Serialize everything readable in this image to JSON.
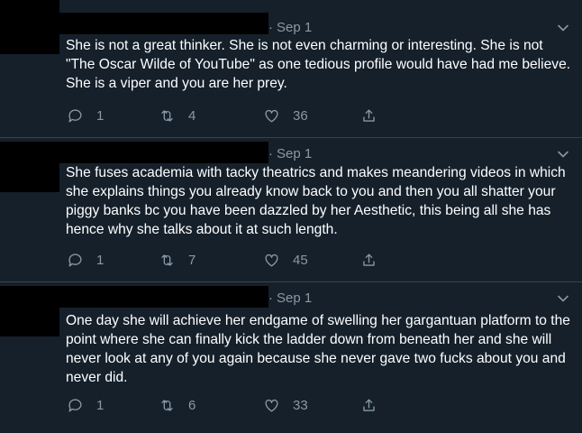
{
  "colors": {
    "background": "#15202b",
    "text": "#ffffff",
    "secondary": "#8899a6",
    "redaction": "#000000"
  },
  "tweets": [
    {
      "date": "Sep 1",
      "text": "She is not a great thinker. She is not even charming or interesting. She is not \"The Oscar Wilde of YouTube\" as one tedious profile would have had me believe. She is a viper and you are her prey.",
      "replies": "1",
      "retweets": "4",
      "likes": "36"
    },
    {
      "date": "Sep 1",
      "text": "She fuses academia with tacky theatrics and makes meandering videos in which she explains things you already know back to you and then you all shatter your piggy banks bc you have been dazzled by her Aesthetic, this being all she has hence why she talks about it at such length.",
      "replies": "1",
      "retweets": "7",
      "likes": "45"
    },
    {
      "date": "Sep 1",
      "text": "One day she will achieve her endgame of swelling her gargantuan platform to the point where she can finally kick the ladder down from beneath her and she will never look at any of you again because she never gave two fucks about you and never did.",
      "replies": "1",
      "retweets": "6",
      "likes": "33"
    }
  ],
  "icons": [
    "reply-icon",
    "retweet-icon",
    "like-icon",
    "share-icon",
    "chevron-down-icon"
  ]
}
